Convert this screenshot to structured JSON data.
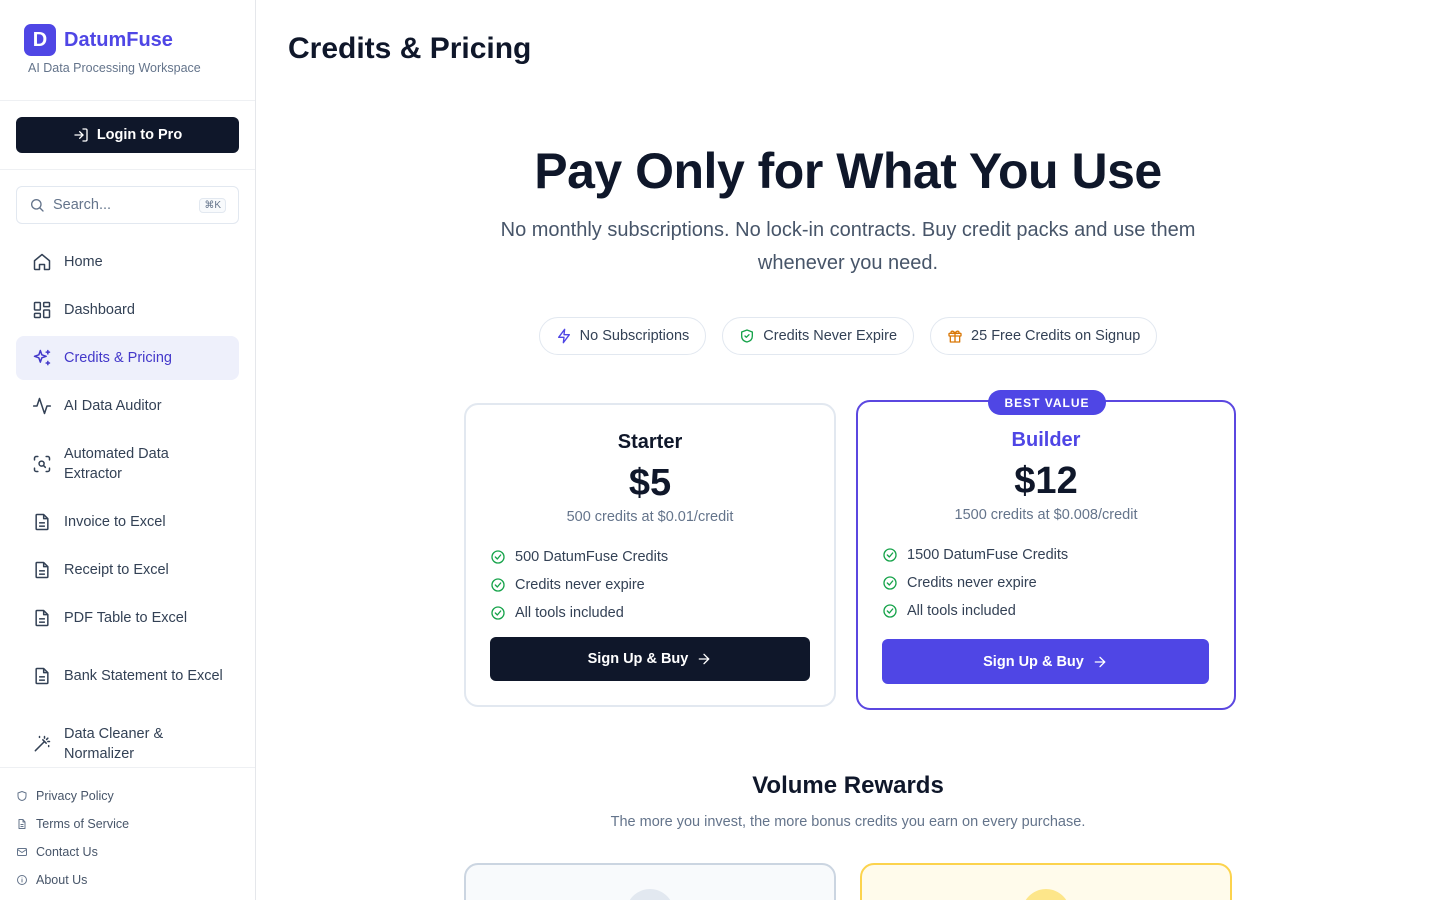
{
  "brand": {
    "logo_letter": "D",
    "name": "DatumFuse",
    "subtitle": "AI Data Processing Workspace"
  },
  "login_button": "Login to Pro",
  "search": {
    "placeholder": "Search...",
    "shortcut": "⌘K"
  },
  "nav": [
    {
      "label": "Home",
      "icon": "home-icon"
    },
    {
      "label": "Dashboard",
      "icon": "dashboard-icon"
    },
    {
      "label": "Credits & Pricing",
      "icon": "sparkles-icon",
      "active": true
    },
    {
      "label": "AI Data Auditor",
      "icon": "activity-icon"
    },
    {
      "label": "Automated Data Extractor",
      "icon": "scan-icon"
    },
    {
      "label": "Invoice to Excel",
      "icon": "file-icon"
    },
    {
      "label": "Receipt to Excel",
      "icon": "file-icon"
    },
    {
      "label": "PDF Table to Excel",
      "icon": "file-icon"
    },
    {
      "label": "Bank Statement to Excel",
      "icon": "file-icon"
    },
    {
      "label": "Data Cleaner & Normalizer",
      "icon": "wand-icon"
    }
  ],
  "footer": [
    {
      "label": "Privacy Policy",
      "icon": "shield-icon"
    },
    {
      "label": "Terms of Service",
      "icon": "file-icon"
    },
    {
      "label": "Contact Us",
      "icon": "mail-icon"
    },
    {
      "label": "About Us",
      "icon": "info-icon"
    }
  ],
  "page": {
    "title": "Credits & Pricing",
    "hero_title": "Pay Only for What You Use",
    "hero_subtitle": "No monthly subscriptions. No lock-in contracts. Buy credit packs and use them whenever you need.",
    "badges": [
      {
        "label": "No Subscriptions",
        "icon": "zap-icon",
        "color": "#4f46e5"
      },
      {
        "label": "Credits Never Expire",
        "icon": "shield-check-icon",
        "color": "#16a34a"
      },
      {
        "label": "25 Free Credits on Signup",
        "icon": "gift-icon",
        "color": "#d97706"
      }
    ]
  },
  "plans": [
    {
      "name": "Starter",
      "price": "$5",
      "description": "500 credits at $0.01/credit",
      "features": [
        "500 DatumFuse Credits",
        "Credits never expire",
        "All tools included"
      ],
      "button": "Sign Up & Buy"
    },
    {
      "name": "Builder",
      "ribbon": "BEST VALUE",
      "price": "$12",
      "description": "1500 credits at $0.008/credit",
      "features": [
        "1500 DatumFuse Credits",
        "Credits never expire",
        "All tools included"
      ],
      "button": "Sign Up & Buy"
    }
  ],
  "volume": {
    "title": "Volume Rewards",
    "subtitle": "The more you invest, the more bonus credits you earn on every purchase."
  },
  "colors": {
    "accent": "#4f46e5",
    "dark": "#0f172a",
    "success": "#16a34a"
  }
}
